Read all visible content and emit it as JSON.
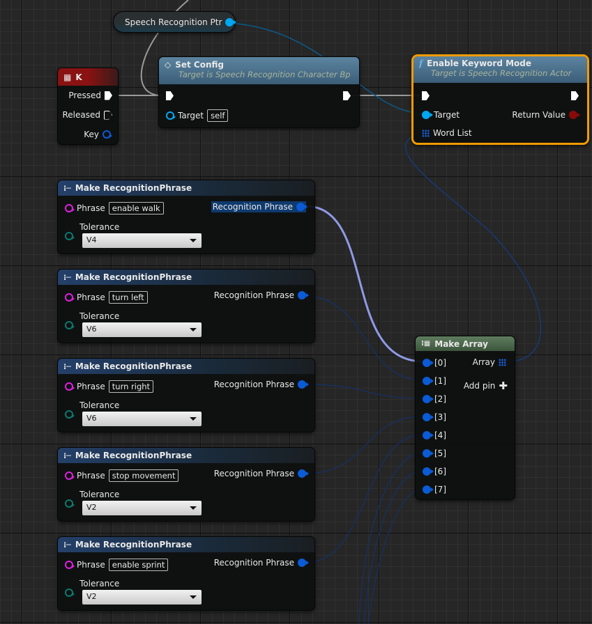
{
  "colors": {
    "accent_selected": "#f29b00",
    "object_pin": "#00a8f2",
    "struct_pin": "#0b5bd6",
    "string_pin": "#e01fe0",
    "enum_pin": "#0a7a6e",
    "return_pin": "#8a0a0a"
  },
  "ptr_node": {
    "label": "Speech Recognition Ptr"
  },
  "event_node": {
    "title": "K",
    "pins": {
      "pressed": "Pressed",
      "released": "Released",
      "key": "Key"
    }
  },
  "set_config": {
    "title": "Set Config",
    "subtitle": "Target is Speech Recognition Character Bp",
    "target_label": "Target",
    "target_value": "self"
  },
  "enable_keyword": {
    "title": "Enable Keyword Mode",
    "subtitle": "Target is Speech Recognition Actor",
    "target_label": "Target",
    "return_label": "Return Value",
    "wordlist_label": "Word List",
    "selected": true
  },
  "phrase_nodes": [
    {
      "title": "Make RecognitionPhrase",
      "phrase_label": "Phrase",
      "phrase": "enable walk",
      "tolerance_label": "Tolerance",
      "tolerance": "V4",
      "output": "Recognition Phrase"
    },
    {
      "title": "Make RecognitionPhrase",
      "phrase_label": "Phrase",
      "phrase": "turn left",
      "tolerance_label": "Tolerance",
      "tolerance": "V6",
      "output": "Recognition Phrase"
    },
    {
      "title": "Make RecognitionPhrase",
      "phrase_label": "Phrase",
      "phrase": "turn right",
      "tolerance_label": "Tolerance",
      "tolerance": "V6",
      "output": "Recognition Phrase"
    },
    {
      "title": "Make RecognitionPhrase",
      "phrase_label": "Phrase",
      "phrase": "stop movement",
      "tolerance_label": "Tolerance",
      "tolerance": "V2",
      "output": "Recognition Phrase"
    },
    {
      "title": "Make RecognitionPhrase",
      "phrase_label": "Phrase",
      "phrase": "enable sprint",
      "tolerance_label": "Tolerance",
      "tolerance": "V2",
      "output": "Recognition Phrase"
    }
  ],
  "make_array": {
    "title": "Make Array",
    "output": "Array",
    "add_pin": "Add pin",
    "inputs": [
      "[0]",
      "[1]",
      "[2]",
      "[3]",
      "[4]",
      "[5]",
      "[6]",
      "[7]"
    ]
  }
}
